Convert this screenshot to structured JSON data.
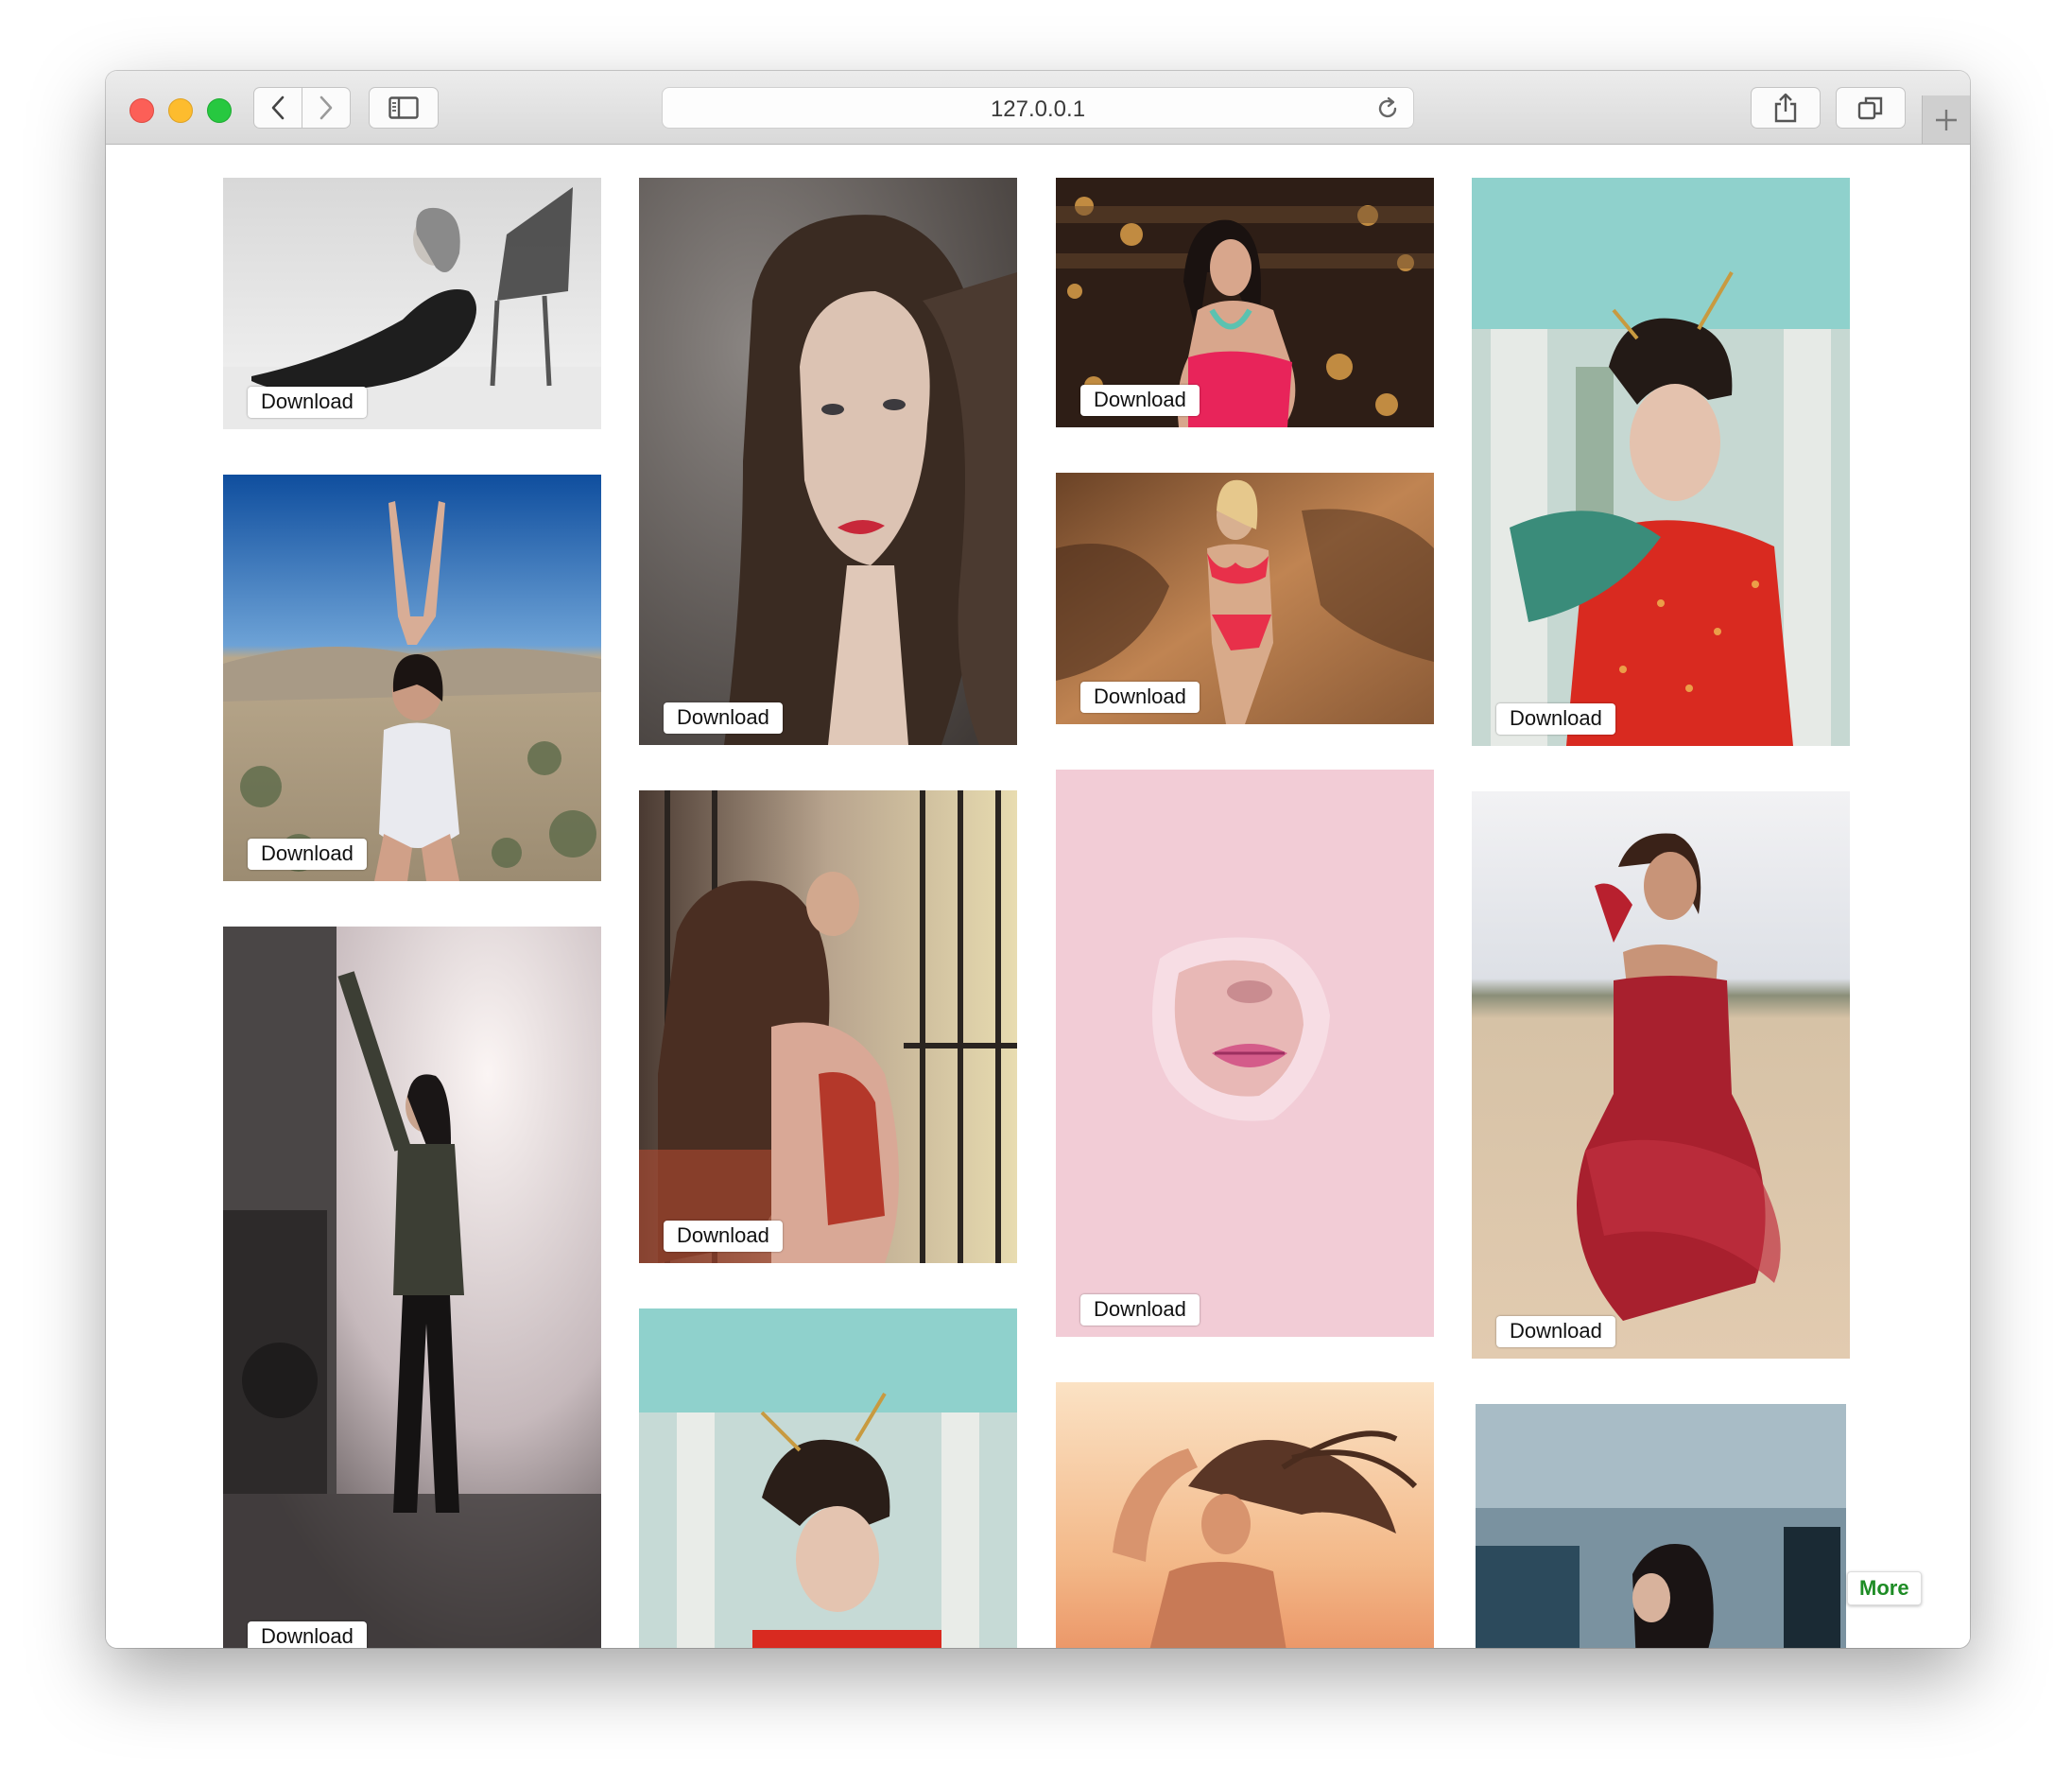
{
  "browser": {
    "address": "127.0.0.1",
    "back_icon": "chevron-left-icon",
    "forward_icon": "chevron-right-icon",
    "sidebar_icon": "sidebar-icon",
    "share_icon": "share-icon",
    "tabs_icon": "tabs-overview-icon",
    "reload_icon": "reload-icon",
    "new_tab_icon": "plus-icon"
  },
  "gallery": {
    "download_label": "Download",
    "more_label": "More",
    "images": [
      {
        "subject": "woman in black bodysuit lying by a chair, black and white",
        "palette": [
          "#f2f2f2",
          "#a8a8a8",
          "#1e1e1e"
        ]
      },
      {
        "subject": "portrait of young woman with curly hair and red lips",
        "palette": [
          "#6e6966",
          "#3a3330",
          "#d8c2b4"
        ]
      },
      {
        "subject": "woman in pink corset with city lights at night",
        "palette": [
          "#3b2418",
          "#c8842f",
          "#e8245a"
        ]
      },
      {
        "subject": "woman in red qipao holding a fan",
        "palette": [
          "#8fd1cc",
          "#cfd6cf",
          "#d92a20"
        ]
      },
      {
        "subject": "woman in white swimsuit arms raised in desert",
        "palette": [
          "#1a5ba6",
          "#b8a890",
          "#e8e8ec"
        ]
      },
      {
        "subject": "woman with long hair at iron gate",
        "palette": [
          "#c9b49a",
          "#6a4a36",
          "#b54a38"
        ]
      },
      {
        "subject": "woman in pink bikini on rocks",
        "palette": [
          "#8a5a38",
          "#c88a56",
          "#e8304a"
        ]
      },
      {
        "subject": "face emerging through torn pink paper",
        "palette": [
          "#f2ccd6",
          "#f0bdcb",
          "#d46a8a"
        ]
      },
      {
        "subject": "woman in red tulle dress in sand",
        "palette": [
          "#e8e8ea",
          "#dcc6ae",
          "#a8202e"
        ]
      },
      {
        "subject": "woman in jacket by train in smoke",
        "palette": [
          "#f4eeee",
          "#c4b8bc",
          "#2a2626"
        ]
      },
      {
        "subject": "woman in red qipao with hair sticks",
        "palette": [
          "#8fd1cc",
          "#cfd6cf",
          "#c83028"
        ]
      },
      {
        "subject": "woman with flowing hair at sunset",
        "palette": [
          "#f6c89a",
          "#e89a6a",
          "#4a2c20"
        ]
      },
      {
        "subject": "woman by blue wall",
        "palette": [
          "#2c4a5c",
          "#90a4b0",
          "#1a1a1a"
        ]
      }
    ]
  }
}
